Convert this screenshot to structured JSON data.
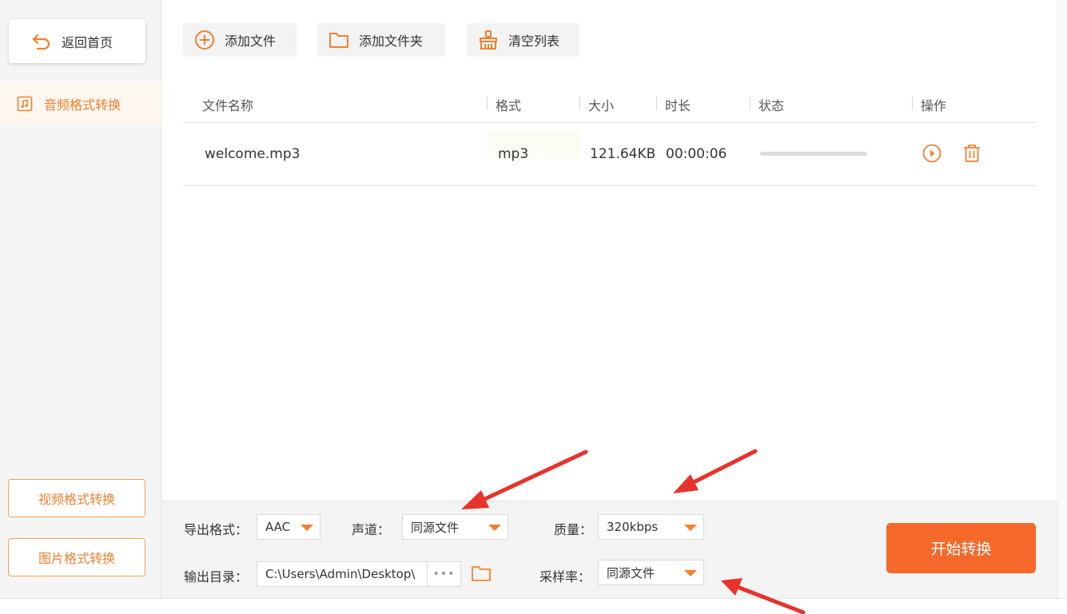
{
  "sidebar": {
    "back_label": "返回首页",
    "active_item": "音频格式转换",
    "video_label": "视频格式转换",
    "image_label": "图片格式转换"
  },
  "toolbar": {
    "add_file": "添加文件",
    "add_folder": "添加文件夹",
    "clear_list": "清空列表"
  },
  "table": {
    "headers": [
      "文件名称",
      "格式",
      "大小",
      "时长",
      "状态",
      "操作"
    ],
    "rows": [
      {
        "name": "welcome.mp3",
        "format": "mp3",
        "size": "121.64KB",
        "duration": "00:00:06",
        "progress": 0
      }
    ]
  },
  "settings": {
    "export_format_label": "导出格式：",
    "export_format_value": "AAC",
    "channel_label": "声道：",
    "channel_value": "同源文件",
    "quality_label": "质量：",
    "quality_value": "320kbps",
    "output_dir_label": "输出目录：",
    "output_dir_value": "C:\\Users\\Admin\\Desktop\\",
    "more_label": "•••",
    "sample_rate_label": "采样率：",
    "sample_rate_value": "同源文件"
  },
  "start_label": "开始转换",
  "colors": {
    "accent": "#f2802f",
    "start_button": "#f6692a",
    "annotation_arrow": "#e8322c"
  }
}
